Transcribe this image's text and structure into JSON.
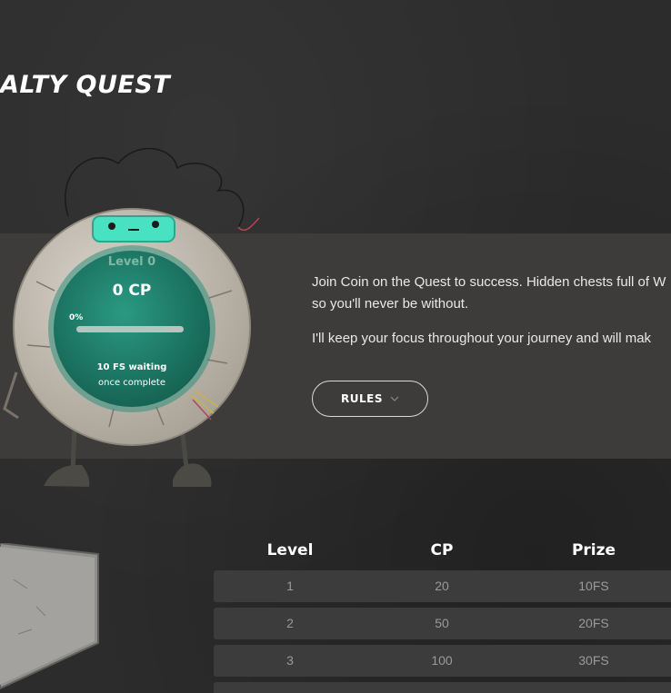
{
  "header": {
    "title": "ALTY QUEST"
  },
  "dial": {
    "level_label": "Level 0",
    "points_label": "0 CP",
    "progress_label": "0%",
    "progress_fraction": 0.0,
    "reward_line": "10 FS waiting",
    "reward_sub": "once complete"
  },
  "intro": {
    "paragraph_1": "Join Coin on the Quest to success. Hidden chests full of W",
    "paragraph_1b": "so you'll never be without.",
    "paragraph_2": "I'll keep your focus throughout your journey and will mak"
  },
  "rules_button": {
    "label": "RULES",
    "icon": "chevron-down-icon"
  },
  "levels_table": {
    "headers": [
      "Level",
      "CP",
      "Prize"
    ],
    "rows": [
      {
        "level": "1",
        "cp": "20",
        "prize": "10FS"
      },
      {
        "level": "2",
        "cp": "50",
        "prize": "20FS"
      },
      {
        "level": "3",
        "cp": "100",
        "prize": "30FS"
      }
    ]
  },
  "colors": {
    "accent": "#3fd3b6",
    "dial_face": "#1f7a68",
    "band": "#3d3c3b",
    "background": "#2c2c2c"
  }
}
